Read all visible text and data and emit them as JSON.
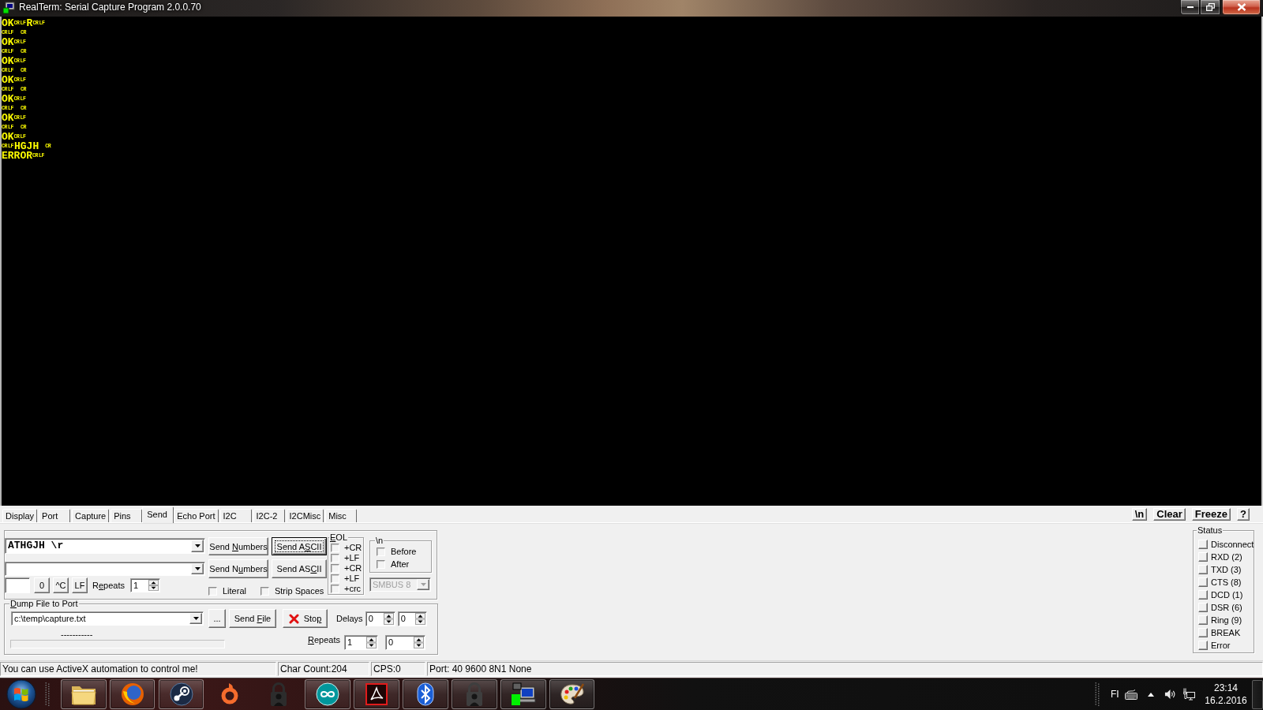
{
  "window": {
    "title": "RealTerm: Serial Capture Program 2.0.0.70"
  },
  "terminal": {
    "lines": [
      [
        {
          "kind": "text",
          "text": "OK"
        },
        {
          "kind": "ctrl",
          "text": "CR"
        },
        {
          "kind": "ctrl",
          "text": "LF"
        },
        {
          "kind": "text",
          "text": "R"
        },
        {
          "kind": "ctrl",
          "text": "CR"
        },
        {
          "kind": "ctrl",
          "text": "LF"
        }
      ],
      [
        {
          "kind": "ctrl",
          "text": "CR"
        },
        {
          "kind": "ctrl",
          "text": "LF"
        },
        {
          "kind": "blank"
        },
        {
          "kind": "ctrl",
          "text": "CR"
        }
      ],
      [
        {
          "kind": "text",
          "text": "OK"
        },
        {
          "kind": "ctrl",
          "text": "CR"
        },
        {
          "kind": "ctrl",
          "text": "LF"
        }
      ],
      [
        {
          "kind": "ctrl",
          "text": "CR"
        },
        {
          "kind": "ctrl",
          "text": "LF"
        },
        {
          "kind": "blank"
        },
        {
          "kind": "ctrl",
          "text": "CR"
        }
      ],
      [
        {
          "kind": "text",
          "text": "OK"
        },
        {
          "kind": "ctrl",
          "text": "CR"
        },
        {
          "kind": "ctrl",
          "text": "LF"
        }
      ],
      [
        {
          "kind": "ctrl",
          "text": "CR"
        },
        {
          "kind": "ctrl",
          "text": "LF"
        },
        {
          "kind": "blank"
        },
        {
          "kind": "ctrl",
          "text": "CR"
        }
      ],
      [
        {
          "kind": "text",
          "text": "OK"
        },
        {
          "kind": "ctrl",
          "text": "CR"
        },
        {
          "kind": "ctrl",
          "text": "LF"
        }
      ],
      [
        {
          "kind": "ctrl",
          "text": "CR"
        },
        {
          "kind": "ctrl",
          "text": "LF"
        },
        {
          "kind": "blank"
        },
        {
          "kind": "ctrl",
          "text": "CR"
        }
      ],
      [
        {
          "kind": "text",
          "text": "OK"
        },
        {
          "kind": "ctrl",
          "text": "CR"
        },
        {
          "kind": "ctrl",
          "text": "LF"
        }
      ],
      [
        {
          "kind": "ctrl",
          "text": "CR"
        },
        {
          "kind": "ctrl",
          "text": "LF"
        },
        {
          "kind": "blank"
        },
        {
          "kind": "ctrl",
          "text": "CR"
        }
      ],
      [
        {
          "kind": "text",
          "text": "OK"
        },
        {
          "kind": "ctrl",
          "text": "CR"
        },
        {
          "kind": "ctrl",
          "text": "LF"
        }
      ],
      [
        {
          "kind": "ctrl",
          "text": "CR"
        },
        {
          "kind": "ctrl",
          "text": "LF"
        },
        {
          "kind": "blank"
        },
        {
          "kind": "ctrl",
          "text": "CR"
        }
      ],
      [
        {
          "kind": "text",
          "text": "OK"
        },
        {
          "kind": "ctrl",
          "text": "CR"
        },
        {
          "kind": "ctrl",
          "text": "LF"
        }
      ],
      [
        {
          "kind": "ctrl",
          "text": "CR"
        },
        {
          "kind": "ctrl",
          "text": "LF"
        },
        {
          "kind": "text",
          "text": "HGJH"
        },
        {
          "kind": "blank"
        },
        {
          "kind": "ctrl",
          "text": "CR"
        }
      ],
      [
        {
          "kind": "text",
          "text": "ERROR"
        },
        {
          "kind": "ctrl",
          "text": "CR"
        },
        {
          "kind": "ctrl",
          "text": "LF"
        }
      ]
    ]
  },
  "tabs": [
    {
      "label": "Display",
      "selected": false
    },
    {
      "label": "Port",
      "selected": false
    },
    {
      "label": "Capture",
      "selected": false
    },
    {
      "label": "Pins",
      "selected": false
    },
    {
      "label": "Send",
      "selected": true
    },
    {
      "label": "Echo Port",
      "selected": false
    },
    {
      "label": "I2C",
      "selected": false
    },
    {
      "label": "I2C-2",
      "selected": false
    },
    {
      "label": "I2CMisc",
      "selected": false
    },
    {
      "label": "Misc",
      "selected": false
    }
  ],
  "view_buttons": [
    "\\n",
    "Clear",
    "Freeze",
    "?"
  ],
  "send": {
    "lines": [
      {
        "value": "ATHGJH \\r",
        "numbers_button": {
          "before": "Send ",
          "hotkey": "N",
          "after": "umbers"
        },
        "ascii_button": {
          "before": "Send A",
          "hotkey": "S",
          "after": "CII",
          "focused": true
        }
      },
      {
        "numbers_button": {
          "before": "Send N",
          "hotkey": "u",
          "after": "mbers"
        },
        "ascii_button": {
          "before": "Send AS",
          "hotkey": "C",
          "after": "II",
          "focused": false
        }
      }
    ],
    "quick_buttons": [
      "0",
      "^C",
      "LF"
    ],
    "repeats": {
      "label": {
        "before": "R",
        "hotkey": "e",
        "after": "peats"
      },
      "value": "1"
    },
    "options": [
      {
        "label": "Literal",
        "checked": false
      },
      {
        "label": "Strip Spaces",
        "checked": false
      }
    ],
    "eol": {
      "legend": {
        "hotkey": "E",
        "after": "OL"
      },
      "options": [
        {
          "label": "+CR",
          "checked": false
        },
        {
          "label": "+LF",
          "checked": false
        },
        {
          "label": "+CR",
          "checked": false
        },
        {
          "label": "+LF",
          "checked": false
        },
        {
          "label": "+crc",
          "checked": false
        }
      ]
    },
    "newline": {
      "legend": "\\n",
      "options": [
        {
          "label": "Before",
          "checked": false
        },
        {
          "label": "After",
          "checked": false
        }
      ]
    },
    "bus": {
      "value": "SMBUS 8",
      "disabled": true
    }
  },
  "dump": {
    "legend": {
      "hotkey": "D",
      "after": "ump File to Port"
    },
    "file": "c:\\temp\\capture.txt",
    "browse_button": "...",
    "send_file_button": {
      "before": "Send ",
      "hotkey": "F",
      "after": "ile"
    },
    "stop_button": {
      "before": "Sto",
      "hotkey": "p"
    },
    "delays": {
      "label": "Delays",
      "values": [
        "0",
        "0"
      ]
    },
    "progress": {
      "caption": "-----------",
      "level": 0
    },
    "repeats": {
      "label": {
        "hotkey": "R",
        "after": "epeats"
      },
      "values": [
        "1",
        "0"
      ]
    }
  },
  "status_panel": {
    "legend": "Status",
    "items": [
      {
        "label": "Disconnect",
        "on": false
      },
      {
        "label": "RXD (2)",
        "on": false
      },
      {
        "label": "TXD (3)",
        "on": false
      },
      {
        "label": "CTS (8)",
        "on": false
      },
      {
        "label": "DCD (1)",
        "on": false
      },
      {
        "label": "DSR (6)",
        "on": false
      },
      {
        "label": "Ring (9)",
        "on": false
      },
      {
        "label": "BREAK",
        "on": false
      },
      {
        "label": "Error",
        "on": false
      }
    ]
  },
  "status_bar": [
    "You can use ActiveX automation to control me!",
    "Char Count:204",
    "CPS:0",
    "Port: 40 9600 8N1 None"
  ],
  "taskbar": {
    "apps": [
      {
        "kind": "folder",
        "running": true
      },
      {
        "kind": "globe",
        "running": true
      },
      {
        "kind": "linked-circles",
        "running": true
      },
      {
        "kind": "ring",
        "running": false
      },
      {
        "kind": "user-lock",
        "running": false
      },
      {
        "kind": "infinity",
        "running": true
      },
      {
        "kind": "swirl-tile",
        "running": true
      },
      {
        "kind": "bluetooth",
        "running": true
      },
      {
        "kind": "user-lock",
        "running": true
      },
      {
        "kind": "computer",
        "running": true
      },
      {
        "kind": "palette",
        "running": true
      }
    ],
    "tray": {
      "language": "FI",
      "time": "23:14",
      "date": "16.2.2016"
    }
  }
}
